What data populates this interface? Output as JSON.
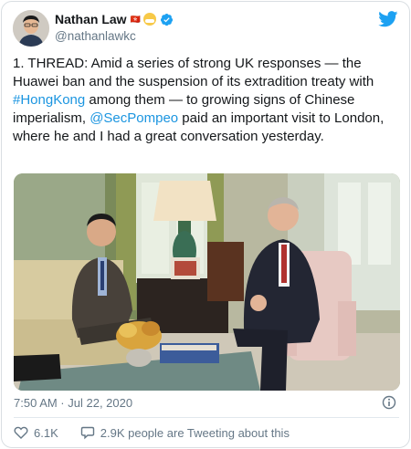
{
  "user": {
    "name": "Nathan Law",
    "flags": "🇭🇰",
    "handle": "@nathanlawkc"
  },
  "tweet": {
    "text_before_link1": "1. THREAD: Amid a series of strong UK responses — the Huawei ban and the suspension of its extradition treaty with ",
    "hashtag": "#HongKong",
    "text_between": " among them — to growing signs of Chinese imperialism, ",
    "mention": "@SecPompeo",
    "text_after": " paid an important visit to London, where he and I had a great conversation yesterday."
  },
  "meta": {
    "timestamp": "7:50 AM · Jul 22, 2020"
  },
  "actions": {
    "likes": "6.1K",
    "tweeting_about": "2.9K people are Tweeting about this"
  },
  "colors": {
    "link": "#1b95e0",
    "twitter_blue": "#1da1f2",
    "secondary_text": "#657786"
  },
  "icons": [
    "twitter-bird-icon",
    "verified-badge-icon",
    "info-icon",
    "heart-icon",
    "speech-bubble-icon"
  ]
}
